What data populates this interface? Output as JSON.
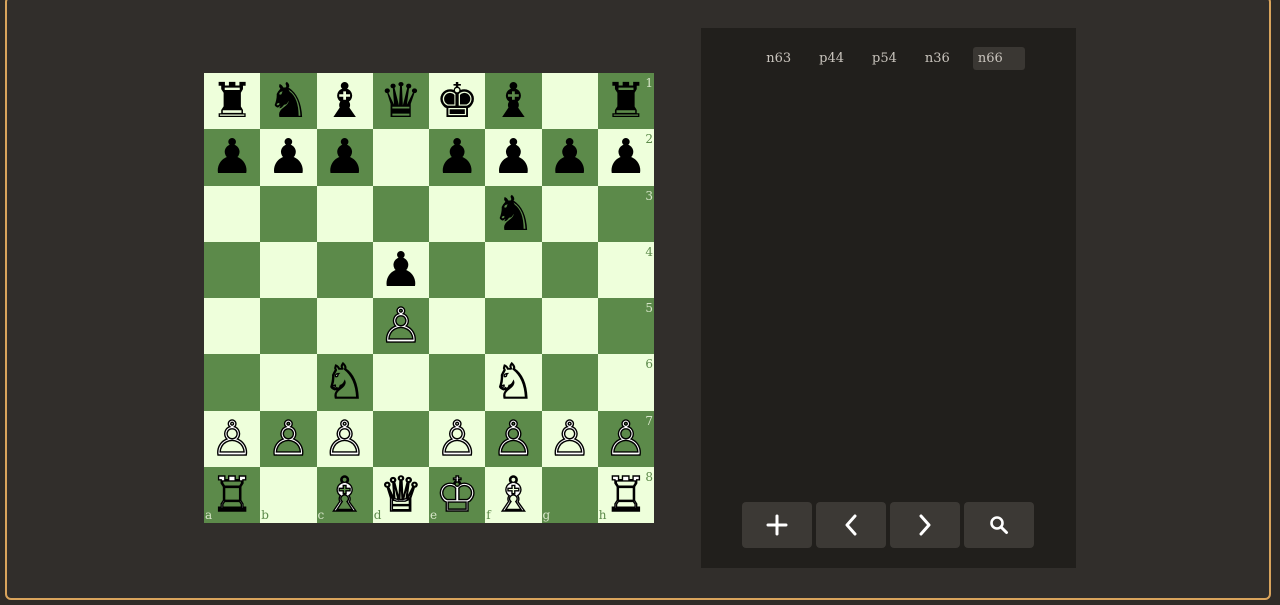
{
  "board": {
    "rows": [
      [
        {
          "p": "♜",
          "c": "black"
        },
        {
          "p": "♞",
          "c": "black"
        },
        {
          "p": "♝",
          "c": "black"
        },
        {
          "p": "♛",
          "c": "black"
        },
        {
          "p": "♚",
          "c": "black"
        },
        {
          "p": "♝",
          "c": "black"
        },
        {
          "p": "",
          "c": ""
        },
        {
          "p": "♜",
          "c": "black"
        }
      ],
      [
        {
          "p": "♟",
          "c": "black"
        },
        {
          "p": "♟",
          "c": "black"
        },
        {
          "p": "♟",
          "c": "black"
        },
        {
          "p": "",
          "c": ""
        },
        {
          "p": "♟",
          "c": "black"
        },
        {
          "p": "♟",
          "c": "black"
        },
        {
          "p": "♟",
          "c": "black"
        },
        {
          "p": "♟",
          "c": "black"
        }
      ],
      [
        {
          "p": "",
          "c": ""
        },
        {
          "p": "",
          "c": ""
        },
        {
          "p": "",
          "c": ""
        },
        {
          "p": "",
          "c": ""
        },
        {
          "p": "",
          "c": ""
        },
        {
          "p": "♞",
          "c": "black"
        },
        {
          "p": "",
          "c": ""
        },
        {
          "p": "",
          "c": ""
        }
      ],
      [
        {
          "p": "",
          "c": ""
        },
        {
          "p": "",
          "c": ""
        },
        {
          "p": "",
          "c": ""
        },
        {
          "p": "♟",
          "c": "black"
        },
        {
          "p": "",
          "c": ""
        },
        {
          "p": "",
          "c": ""
        },
        {
          "p": "",
          "c": ""
        },
        {
          "p": "",
          "c": ""
        }
      ],
      [
        {
          "p": "",
          "c": ""
        },
        {
          "p": "",
          "c": ""
        },
        {
          "p": "",
          "c": ""
        },
        {
          "p": "♙",
          "c": "white"
        },
        {
          "p": "",
          "c": ""
        },
        {
          "p": "",
          "c": ""
        },
        {
          "p": "",
          "c": ""
        },
        {
          "p": "",
          "c": ""
        }
      ],
      [
        {
          "p": "",
          "c": ""
        },
        {
          "p": "",
          "c": ""
        },
        {
          "p": "♘",
          "c": "white"
        },
        {
          "p": "",
          "c": ""
        },
        {
          "p": "",
          "c": ""
        },
        {
          "p": "♘",
          "c": "white"
        },
        {
          "p": "",
          "c": ""
        },
        {
          "p": "",
          "c": ""
        }
      ],
      [
        {
          "p": "♙",
          "c": "white"
        },
        {
          "p": "♙",
          "c": "white"
        },
        {
          "p": "♙",
          "c": "white"
        },
        {
          "p": "",
          "c": ""
        },
        {
          "p": "♙",
          "c": "white"
        },
        {
          "p": "♙",
          "c": "white"
        },
        {
          "p": "♙",
          "c": "white"
        },
        {
          "p": "♙",
          "c": "white"
        }
      ],
      [
        {
          "p": "♖",
          "c": "white"
        },
        {
          "p": "",
          "c": ""
        },
        {
          "p": "♗",
          "c": "white"
        },
        {
          "p": "♕",
          "c": "white"
        },
        {
          "p": "♔",
          "c": "white"
        },
        {
          "p": "♗",
          "c": "white"
        },
        {
          "p": "",
          "c": ""
        },
        {
          "p": "♖",
          "c": "white"
        }
      ]
    ],
    "ranks": [
      "1",
      "2",
      "3",
      "4",
      "5",
      "6",
      "7",
      "8"
    ],
    "files": [
      "a",
      "b",
      "c",
      "d",
      "e",
      "f",
      "g",
      "h"
    ],
    "light_color": "#eeffdb",
    "dark_color": "#5c8a4a"
  },
  "moves": [
    {
      "label": "n63",
      "active": false
    },
    {
      "label": "p44",
      "active": false
    },
    {
      "label": "p54",
      "active": false
    },
    {
      "label": "n36",
      "active": false
    },
    {
      "label": "n66",
      "active": true
    }
  ],
  "controls": [
    {
      "name": "add-button",
      "icon": "plus-icon"
    },
    {
      "name": "previous-button",
      "icon": "chevron-left-icon"
    },
    {
      "name": "next-button",
      "icon": "chevron-right-icon"
    },
    {
      "name": "search-button",
      "icon": "search-icon"
    }
  ]
}
